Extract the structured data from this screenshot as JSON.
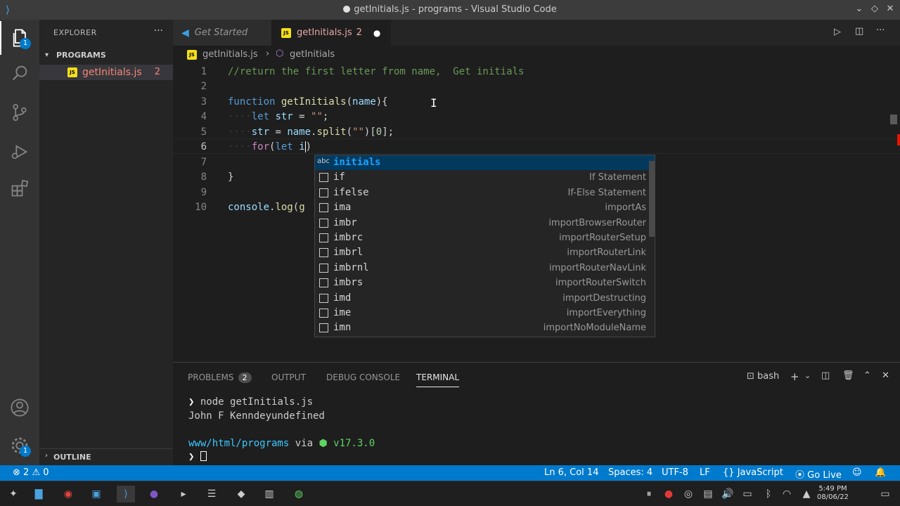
{
  "window": {
    "title": "getInitials.js - programs - Visual Studio Code"
  },
  "activity": {
    "explorer_badge": "1",
    "settings_badge": "1"
  },
  "sidebar": {
    "title": "EXPLORER",
    "more": "···",
    "section": "PROGRAMS",
    "file": {
      "name": "getInitials.js",
      "problems": "2"
    },
    "outline": "OUTLINE"
  },
  "tabs": [
    {
      "label": "Get Started"
    },
    {
      "label": "getInitials.js",
      "problems": "2"
    }
  ],
  "breadcrumb": {
    "file": "getInitials.js",
    "symbol": "getInitials"
  },
  "editor": {
    "lines": [
      "1",
      "2",
      "3",
      "4",
      "5",
      "6",
      "7",
      "8",
      "9",
      "10"
    ],
    "code": {
      "l1": "//return the first letter from name,  Get initials",
      "l3_kw": "function",
      "l3_fn": "getInitials",
      "l3_param": "name",
      "l4_kw": "let",
      "l4_var": "str",
      "l4_str": "\"\"",
      "l5_var": "str",
      "l5_obj": "name",
      "l5_fn": "split",
      "l5_str": "\"\"",
      "l5_idx": "0",
      "l6_kw": "for",
      "l6_let": "let",
      "l6_var": "i",
      "l8": "}",
      "l10_obj": "console",
      "l10_fn": "log",
      "l10_rest": "g"
    }
  },
  "suggest": {
    "items": [
      {
        "label": "initials",
        "detail": ""
      },
      {
        "label": "if",
        "detail": "If Statement"
      },
      {
        "label": "ifelse",
        "detail": "If-Else Statement"
      },
      {
        "label": "ima",
        "detail": "importAs"
      },
      {
        "label": "imbr",
        "detail": "importBrowserRouter"
      },
      {
        "label": "imbrc",
        "detail": "importRouterSetup"
      },
      {
        "label": "imbrl",
        "detail": "importRouterLink"
      },
      {
        "label": "imbrnl",
        "detail": "importRouterNavLink"
      },
      {
        "label": "imbrs",
        "detail": "importRouterSwitch"
      },
      {
        "label": "imd",
        "detail": "importDestructing"
      },
      {
        "label": "ime",
        "detail": "importEverything"
      },
      {
        "label": "imn",
        "detail": "importNoModuleName"
      }
    ]
  },
  "panel": {
    "tabs": {
      "problems": "PROBLEMS",
      "problems_count": "2",
      "output": "OUTPUT",
      "debug": "DEBUG CONSOLE",
      "terminal": "TERMINAL"
    },
    "shell": "bash",
    "terminal": {
      "prompt": "❯",
      "cmd": "node getInitials.js",
      "output": "John F Kenndeyundefined",
      "path": "www/html/programs",
      "via": "via",
      "node_version": "v17.3.0"
    }
  },
  "status": {
    "errors": "2",
    "warnings": "0",
    "position": "Ln 6, Col 14",
    "spaces": "Spaces: 4",
    "encoding": "UTF-8",
    "eol": "LF",
    "language": "JavaScript",
    "golive": "Go Live"
  },
  "taskbar": {
    "time": "5:49 PM",
    "date": "08/06/22"
  }
}
